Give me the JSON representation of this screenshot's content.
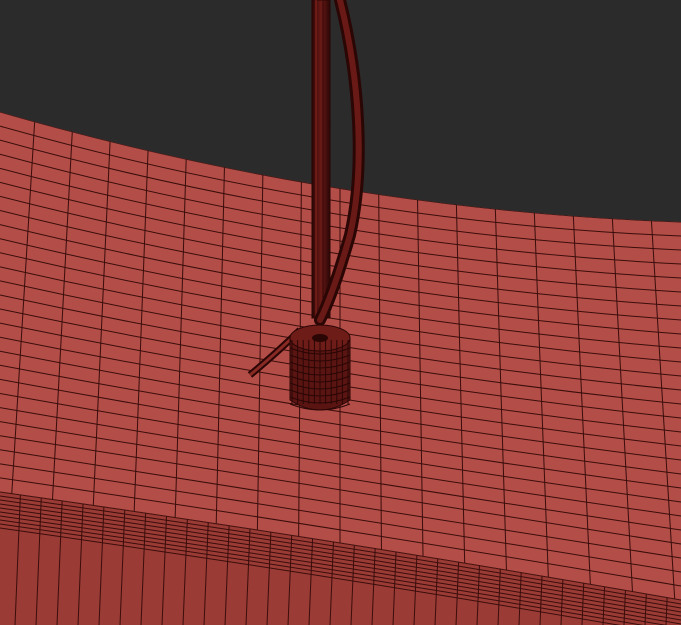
{
  "scene": {
    "kind": "3d-viewport-wireframe",
    "background_color": "#2b2b2b",
    "surface_fill": "#b24d47",
    "surface_shadow": "#9a3b35",
    "wire_color": "#3a0d0b",
    "cable_fill": "#5a1512",
    "cable_edge": "#2a0605"
  },
  "objects": [
    {
      "name": "ring-surface",
      "description": ""
    },
    {
      "name": "cable-connector",
      "description": ""
    },
    {
      "name": "cable-bundle",
      "description": ""
    }
  ]
}
